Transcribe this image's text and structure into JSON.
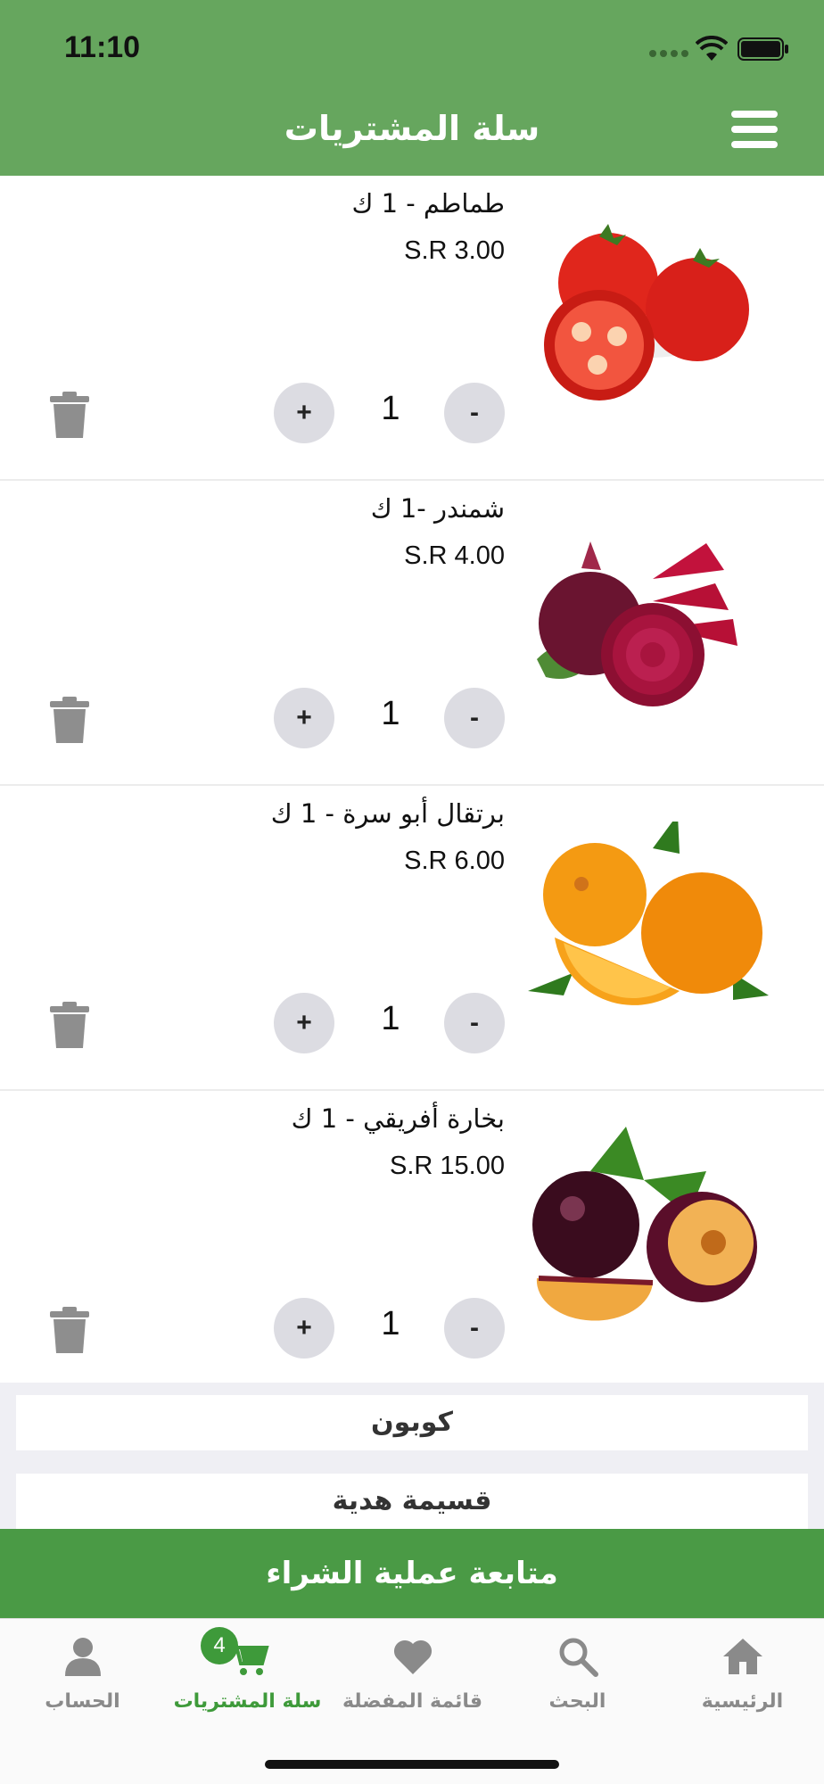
{
  "status_bar": {
    "time": "11:10"
  },
  "header": {
    "title": "سلة المشتريات"
  },
  "items": [
    {
      "name": "طماطم - 1 ك",
      "price": "S.R 3.00",
      "quantity": "1",
      "minus": "-",
      "plus": "+",
      "image": "tomatoes"
    },
    {
      "name": "شمندر -1 ك",
      "price": "S.R 4.00",
      "quantity": "1",
      "minus": "-",
      "plus": "+",
      "image": "beetroot"
    },
    {
      "name": "برتقال أبو سرة - 1 ك",
      "price": "S.R 6.00",
      "quantity": "1",
      "minus": "-",
      "plus": "+",
      "image": "oranges"
    },
    {
      "name": "بخارة أفريقي - 1 ك",
      "price": "S.R 15.00",
      "quantity": "1",
      "minus": "-",
      "plus": "+",
      "image": "plums"
    }
  ],
  "extras": {
    "coupon": "كوبون",
    "gift_card": "قسيمة هدية"
  },
  "checkout": {
    "label": "متابعة عملية الشراء"
  },
  "tabbar": {
    "cart_badge": "4",
    "tabs": [
      {
        "label": "الحساب",
        "icon": "person-icon"
      },
      {
        "label": "سلة المشتريات",
        "icon": "cart-icon",
        "active": true
      },
      {
        "label": "قائمة المفضلة",
        "icon": "heart-icon"
      },
      {
        "label": "البحث",
        "icon": "search-icon"
      },
      {
        "label": "الرئيسية",
        "icon": "home-icon"
      }
    ]
  },
  "colors": {
    "header_bg": "#66a65e",
    "checkout_bg": "#4a9a45",
    "active_tab": "#3e9a3a",
    "inactive_tab": "#8a8a8a"
  }
}
